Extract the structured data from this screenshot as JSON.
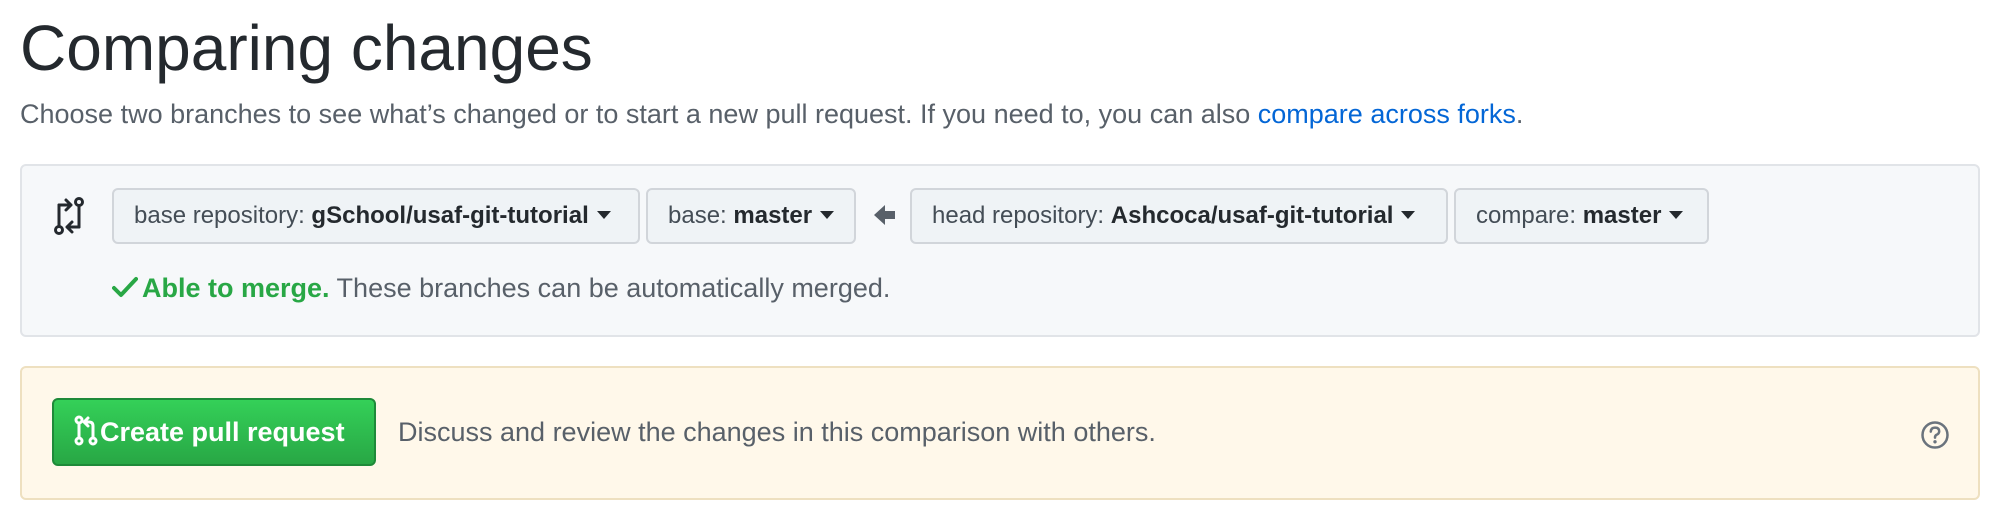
{
  "header": {
    "title": "Comparing changes",
    "subtitle_prefix": "Choose two branches to see what’s changed or to start a new pull request. If you need to, you can also ",
    "subtitle_link": "compare across forks",
    "subtitle_suffix": "."
  },
  "range": {
    "base_repository": {
      "label": "base repository: ",
      "value": "gSchool/usaf-git-tutorial"
    },
    "base_branch": {
      "label": "base: ",
      "value": "master"
    },
    "head_repository": {
      "label": "head repository: ",
      "value": "Ashcoca/usaf-git-tutorial"
    },
    "compare_branch": {
      "label": "compare: ",
      "value": "master"
    }
  },
  "merge": {
    "status": "Able to merge.",
    "message": " These branches can be automatically merged."
  },
  "pull_request": {
    "button_label": "Create pull request",
    "description": "Discuss and review the changes in this comparison with others."
  },
  "colors": {
    "link": "#0366d6",
    "success": "#28a745",
    "button_green": "#2ea44f",
    "notice_bg": "#fff8ea"
  },
  "icons": [
    "git-compare-icon",
    "arrow-left-icon",
    "check-icon",
    "git-pull-request-icon",
    "question-icon"
  ]
}
